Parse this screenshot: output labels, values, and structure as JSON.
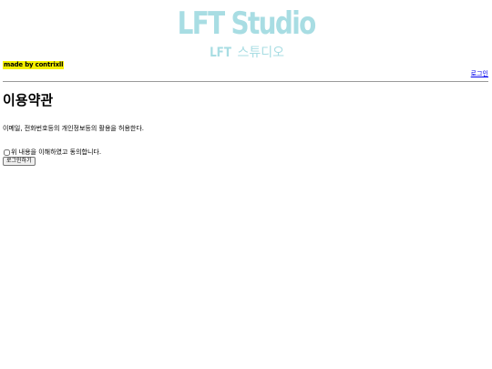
{
  "header": {
    "logo_title": "LFT Studio",
    "logo_sub_brand": "LFT",
    "logo_sub_text": " 스튜디오",
    "made_by": "made by contrixll",
    "login_link": "로그인"
  },
  "main": {
    "title": "이용약관",
    "consent_text": "이메일, 전화번호등의 개인정보등의 활용을 허용한다.",
    "agree_label": "위 내용을 이해하였고 동의합니다.",
    "agree_checked": false,
    "login_button": "로그인하기"
  },
  "colors": {
    "logo": "#a8dde3",
    "made_by_background": "#f4f000",
    "link": "#0000ee"
  }
}
